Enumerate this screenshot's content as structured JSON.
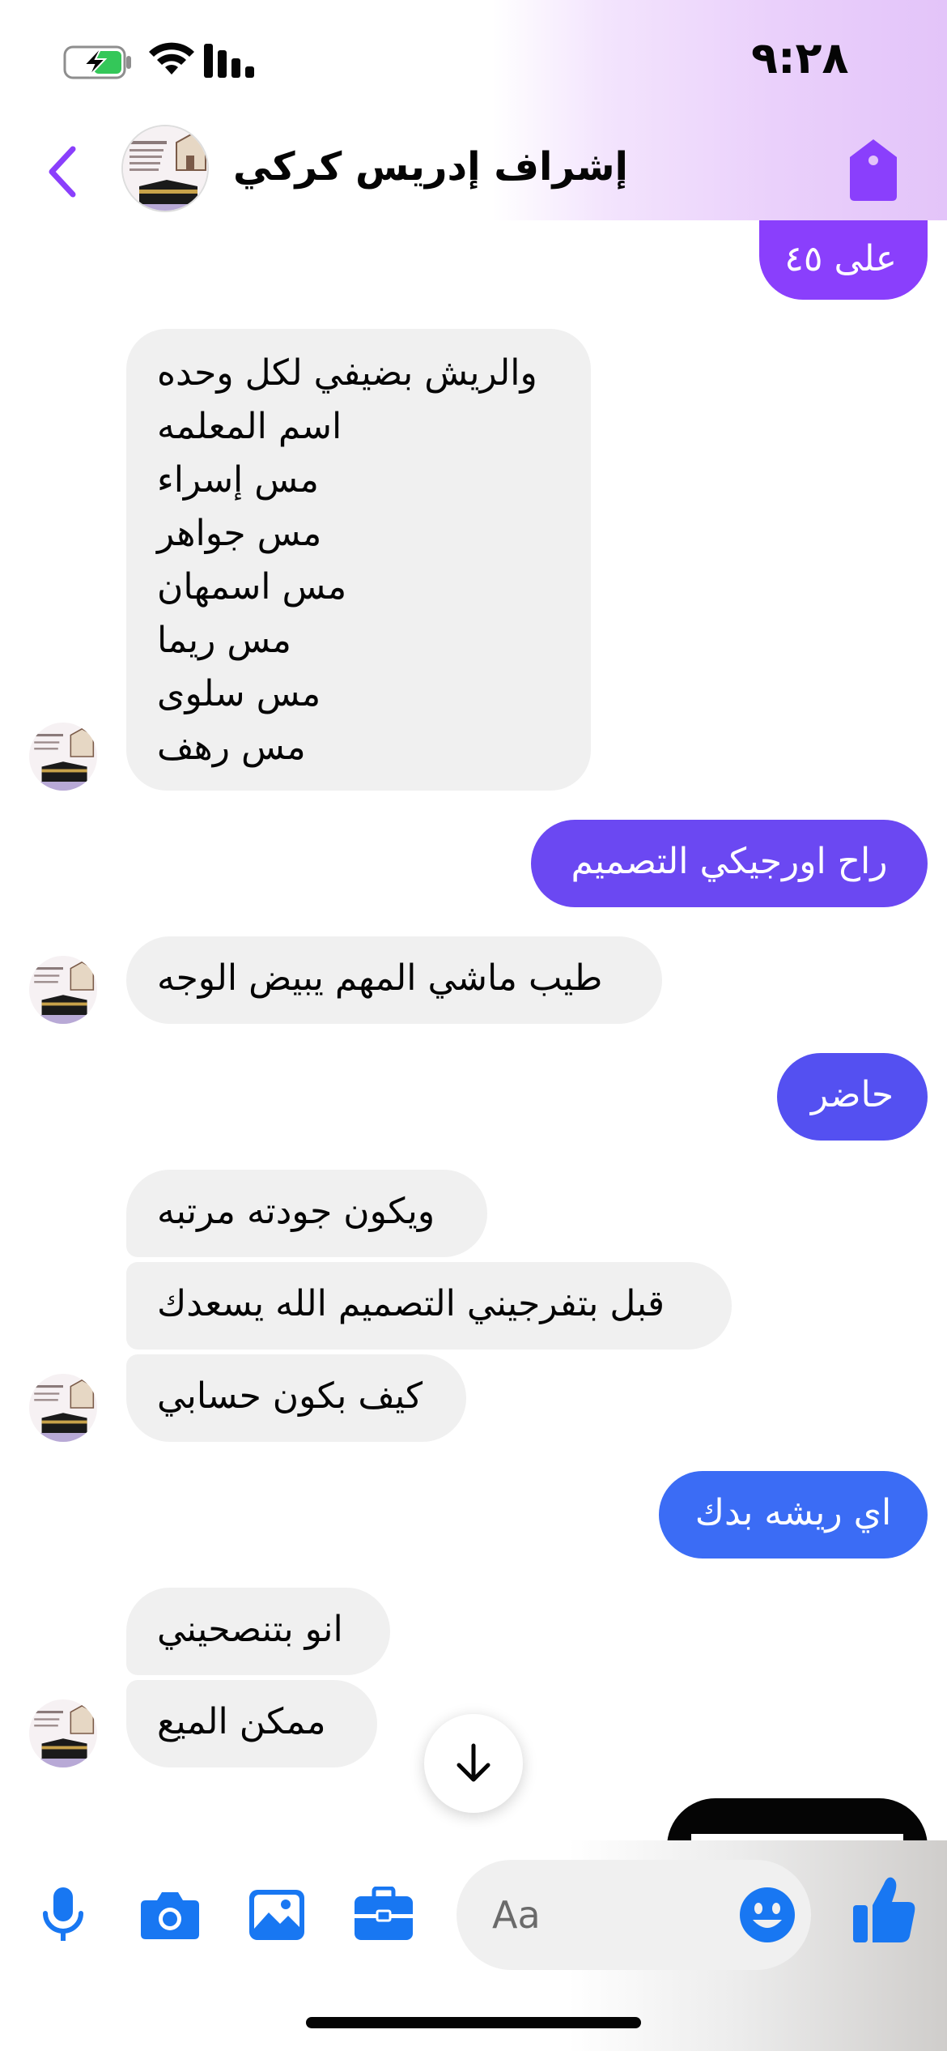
{
  "status_bar": {
    "time": "٩:٢٨"
  },
  "header": {
    "contact_name": "إشراف إدريس كركي"
  },
  "colors": {
    "accent_top": "#8a3ffc",
    "accent_mid": "#5b4df0",
    "accent_bottom": "#3b6cf5",
    "incoming_bubble": "#f0f0f0",
    "icon_blue": "#1877f2"
  },
  "messages": [
    {
      "id": "m1",
      "direction": "outgoing",
      "text": "على ٤٥"
    },
    {
      "id": "m2",
      "direction": "incoming",
      "lines": [
        "والريش بضيفي لكل وحده",
        "اسم المعلمه",
        "مس إسراء",
        "مس جواهر",
        "مس اسمهان",
        "مس ريما",
        "مس سلوى",
        "مس رهف"
      ]
    },
    {
      "id": "m3",
      "direction": "outgoing",
      "text": "راح اورجيكي التصميم"
    },
    {
      "id": "m4",
      "direction": "incoming",
      "text": "طيب ماشي المهم يبيض الوجه"
    },
    {
      "id": "m5",
      "direction": "outgoing",
      "text": "حاضر"
    },
    {
      "id": "m6",
      "direction": "incoming",
      "text": "ويكون جودته مرتبه"
    },
    {
      "id": "m7",
      "direction": "incoming",
      "text": "قبل بتفرجيني التصميم الله يسعدك"
    },
    {
      "id": "m8",
      "direction": "incoming",
      "text": "كيف بكون حسابي"
    },
    {
      "id": "m9",
      "direction": "outgoing",
      "text": "اي ريشه بدك"
    },
    {
      "id": "m10",
      "direction": "incoming",
      "text": "انو بتنصحيني"
    },
    {
      "id": "m11",
      "direction": "incoming",
      "text": "ممكن الميع"
    }
  ],
  "composer": {
    "placeholder": "Aa",
    "icons": [
      "microphone-icon",
      "camera-icon",
      "image-icon",
      "briefcase-icon",
      "emoji-icon",
      "thumbs-up-icon"
    ]
  }
}
